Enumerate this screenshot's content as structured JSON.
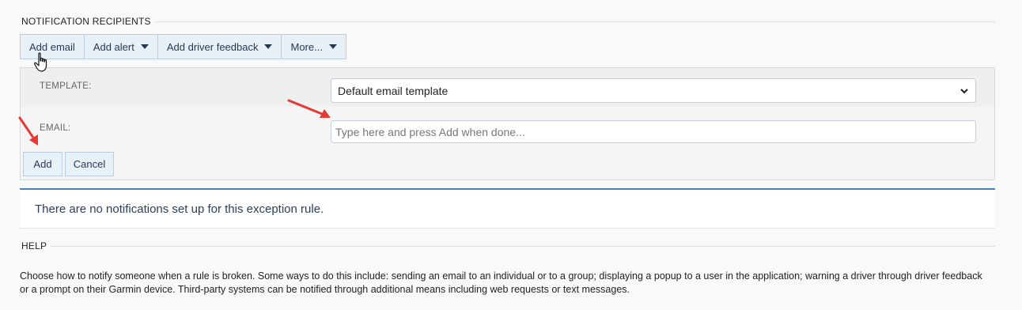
{
  "sections": {
    "recipients_title": "NOTIFICATION RECIPIENTS",
    "help_title": "HELP"
  },
  "toolbar": {
    "add_email": "Add email",
    "add_alert": "Add alert",
    "add_driver_feedback": "Add driver feedback",
    "more": "More..."
  },
  "form": {
    "template_label": "TEMPLATE:",
    "template_value": "Default email template",
    "email_label": "EMAIL:",
    "email_placeholder": "Type here and press Add when done...",
    "email_value": "",
    "add_label": "Add",
    "cancel_label": "Cancel"
  },
  "notice": {
    "text": "There are no notifications set up for this exception rule."
  },
  "help": {
    "text": "Choose how to notify someone when a rule is broken. Some ways to do this include: sending an email to an individual or to a group; displaying a popup to a user in the application; warning a driver through driver feedback or a prompt on their Garmin device. Third-party systems can be notified through additional means including web requests or text messages."
  },
  "icons": {
    "dropdown": "caret-down-icon",
    "select": "chevron-down-icon",
    "cursor": "hand-pointer-icon",
    "annotation": "red-arrow-icon"
  },
  "colors": {
    "button_bg": "#e8f0f8",
    "button_border": "#b9cde0",
    "accent": "#4a7fb4",
    "annotation_arrow": "#e53935"
  }
}
